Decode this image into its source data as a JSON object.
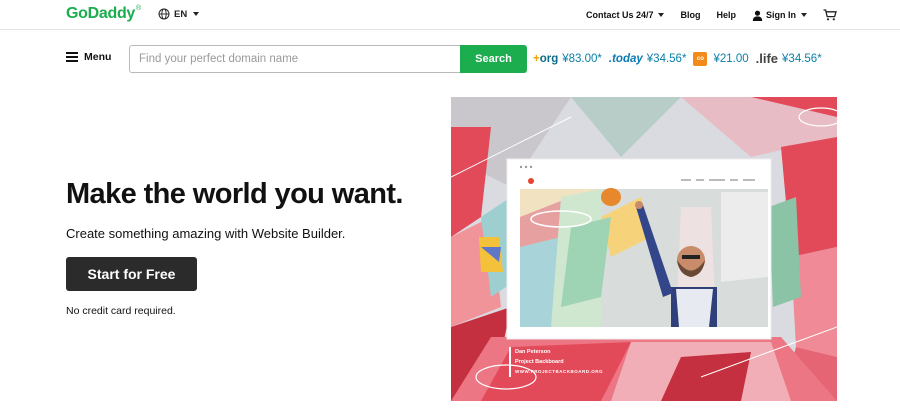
{
  "header": {
    "logo": "GoDaddy",
    "logo_mark": "®",
    "language": "EN",
    "nav": {
      "contact": "Contact Us 24/7",
      "blog": "Blog",
      "help": "Help",
      "sign_in": "Sign In"
    }
  },
  "search": {
    "menu_label": "Menu",
    "placeholder": "Find your perfect domain name",
    "button_label": "Search",
    "tlds": [
      {
        "name": "org",
        "price": "¥83.00*"
      },
      {
        "name": ".today",
        "price": "¥34.56*"
      },
      {
        "name": "co",
        "price": "¥21.00"
      },
      {
        "name": ".life",
        "price": "¥34.56*"
      }
    ]
  },
  "hero": {
    "headline": "Make the world you want.",
    "subheadline": "Create something amazing with Website Builder.",
    "cta_label": "Start for Free",
    "note": "No credit card required.",
    "image": {
      "site_name": "PROJECT BACKBOARD",
      "nav_items": [
        "ABOUT",
        "WORK",
        "GALLERY/PRESS",
        "SHOP",
        "SOCIAL"
      ],
      "caption_name": "Dan Peterson",
      "caption_project": "Project Backboard",
      "caption_url": "WWW.PROJECTBACKBOARD.ORG"
    }
  },
  "colors": {
    "brand_green": "#1bad4e",
    "price_blue": "#097fa8",
    "cta_dark": "#2b2b2b"
  },
  "icons": {
    "language": "globe-icon",
    "user": "user-icon",
    "cart": "cart-icon",
    "menu": "hamburger-icon"
  }
}
